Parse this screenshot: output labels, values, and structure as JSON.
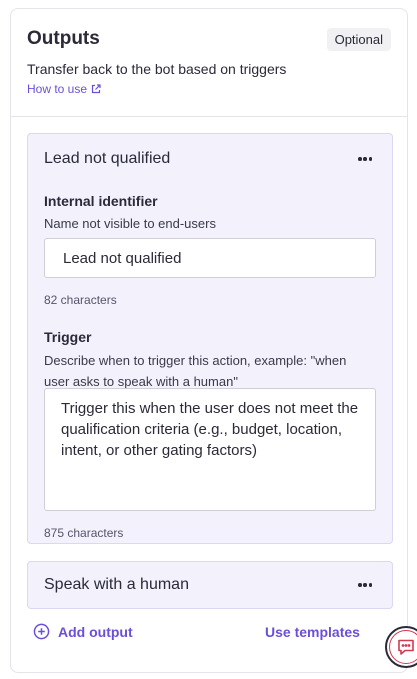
{
  "header": {
    "title": "Outputs",
    "badge": "Optional",
    "subtitle": "Transfer back to the bot based on triggers",
    "how_to_link": "How to use"
  },
  "outputs": [
    {
      "title": "Lead not qualified",
      "identifier_label": "Internal identifier",
      "identifier_help": "Name not visible to end-users",
      "identifier_value": "Lead not qualified",
      "identifier_count": "82 characters",
      "trigger_label": "Trigger",
      "trigger_help": "Describe when to trigger this action, example: \"when user asks to speak with a human\"",
      "trigger_value": "Trigger this when the user does not meet the qualification criteria (e.g., budget, location, intent, or other gating factors)",
      "trigger_count": "875 characters"
    },
    {
      "title": "Speak with a human"
    }
  ],
  "footer": {
    "add_output": "Add output",
    "use_templates": "Use templates"
  },
  "colors": {
    "accent": "#6c4fd8",
    "card_bg": "#f3f1fc",
    "border": "#e4e4ea",
    "chat_icon": "#d23a52"
  },
  "icons": {
    "external_link": "external-link-icon",
    "more": "more-horizontal-icon",
    "add": "plus-circle-icon",
    "chat": "chat-bubble-icon"
  }
}
